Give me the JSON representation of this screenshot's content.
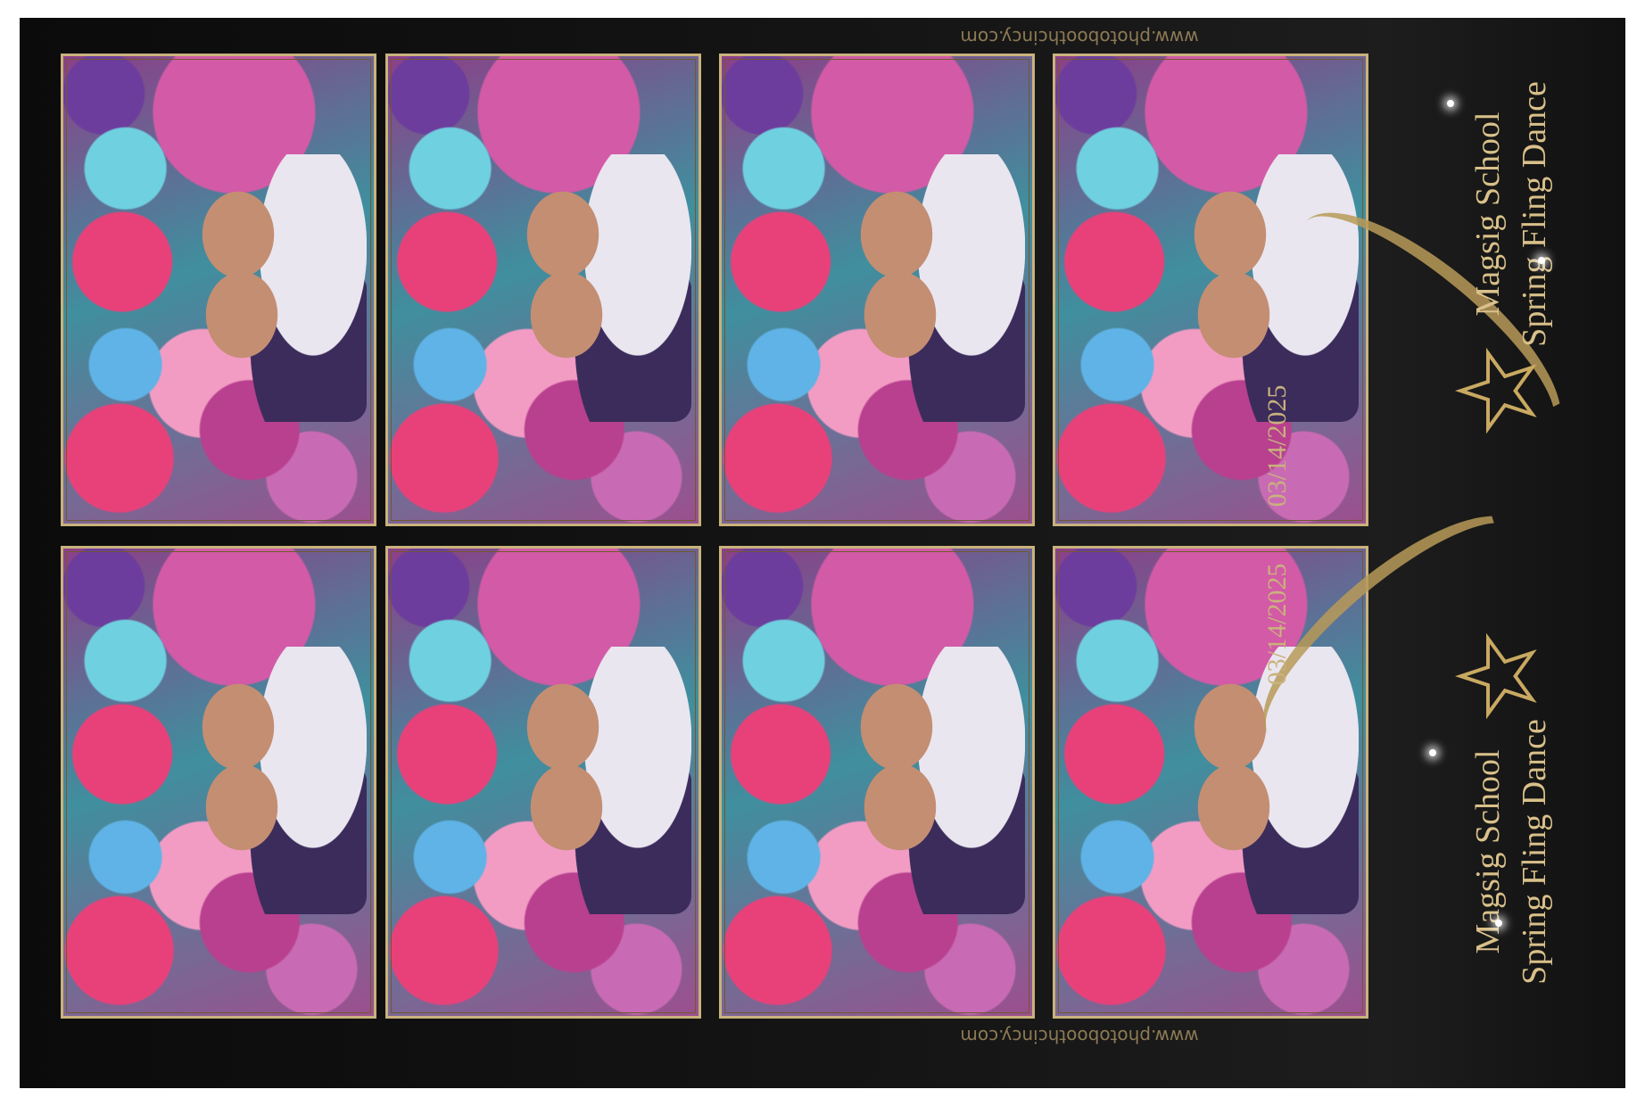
{
  "event": {
    "line1": "Magsig School",
    "line2": "Spring Fling Dance",
    "date": "03/14/2025",
    "url": "www.photoboothcincy.com"
  },
  "strips": [
    {
      "name": "top",
      "photos": 4
    },
    {
      "name": "bottom",
      "photos": 4
    }
  ],
  "icons": {
    "star": "star-icon",
    "sparkle": "sparkle-icon",
    "ribbon": "gold-ribbon"
  },
  "colors": {
    "background": "#111111",
    "gold": "#c9b27c",
    "frame": "#c9b27c"
  }
}
